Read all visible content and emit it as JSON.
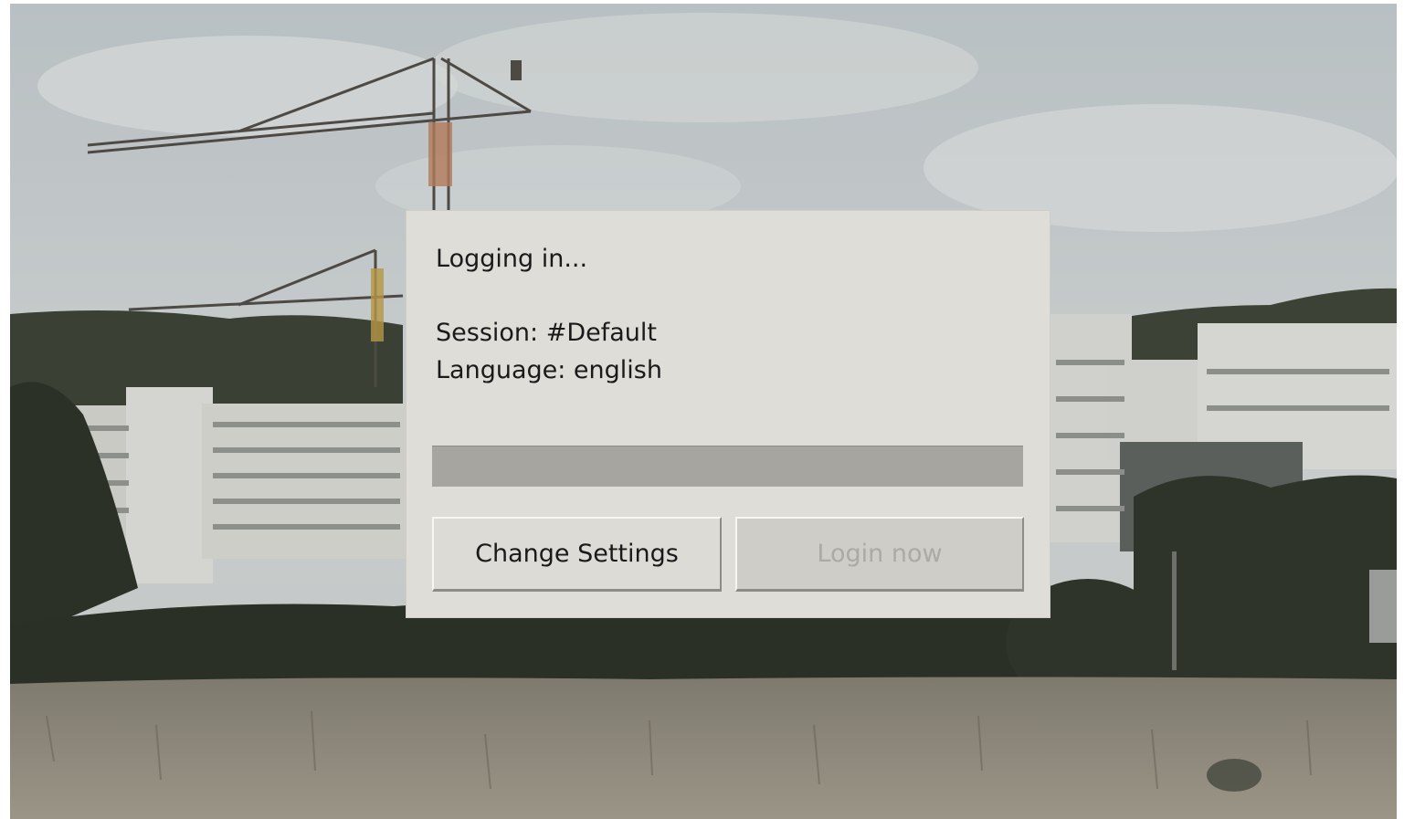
{
  "dialog": {
    "status": "Logging in...",
    "session": "Session: #Default",
    "language": "Language: english",
    "progress": 0,
    "change_settings_label": "Change Settings",
    "login_now_label": "Login now",
    "login_now_enabled": false
  },
  "colors": {
    "dialog_bg": "#deddd8",
    "progress_track": "#a7a59f",
    "text": "#1a1a1a",
    "disabled_text": "#acaaa4"
  }
}
